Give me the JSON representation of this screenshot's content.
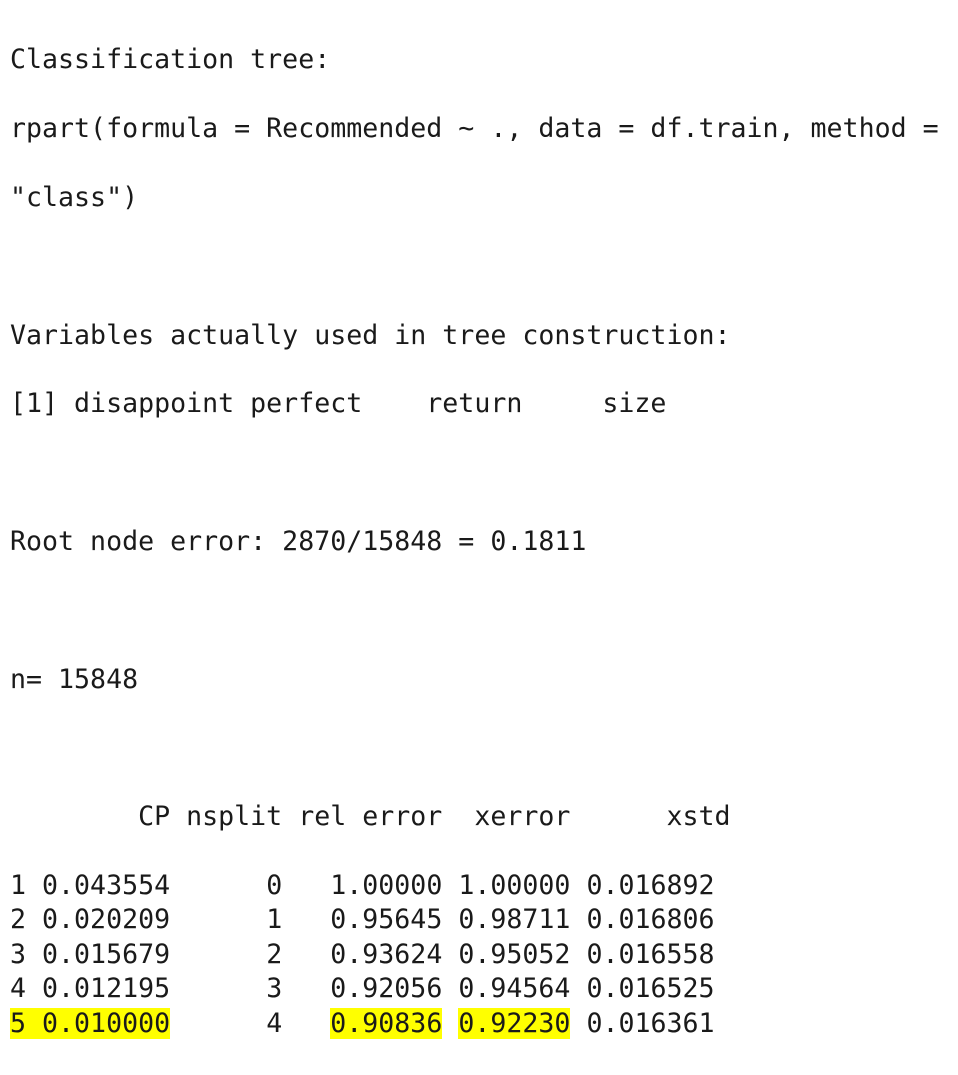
{
  "header": {
    "title": "Classification tree:",
    "call_line1": "rpart(formula = Recommended ~ ., data = df.train, method =",
    "call_line2": "\"class\")"
  },
  "variables": {
    "heading": "Variables actually used in tree construction:",
    "list": "[1] disappoint perfect    return     size"
  },
  "root": {
    "text": "Root node error: 2870/15848 = 0.1811"
  },
  "n": {
    "text": "n= 15848"
  },
  "cp_table": {
    "header": "        CP nsplit rel error  xerror      xstd",
    "rows": [
      {
        "idx": "1",
        "cp": "0.043554",
        "nsplit": "0",
        "rel_error": "1.00000",
        "xerror": "1.00000",
        "xstd": "0.016892"
      },
      {
        "idx": "2",
        "cp": "0.020209",
        "nsplit": "1",
        "rel_error": "0.95645",
        "xerror": "0.98711",
        "xstd": "0.016806"
      },
      {
        "idx": "3",
        "cp": "0.015679",
        "nsplit": "2",
        "rel_error": "0.93624",
        "xerror": "0.95052",
        "xstd": "0.016558"
      },
      {
        "idx": "4",
        "cp": "0.012195",
        "nsplit": "3",
        "rel_error": "0.92056",
        "xerror": "0.94564",
        "xstd": "0.016525"
      },
      {
        "idx": "5",
        "cp": "0.010000",
        "nsplit": "4",
        "rel_error": "0.90836",
        "xerror": "0.92230",
        "xstd": "0.016361"
      }
    ]
  },
  "colors": {
    "highlight": "#ffff00",
    "text": "#1a1a1a",
    "background": "#ffffff"
  }
}
